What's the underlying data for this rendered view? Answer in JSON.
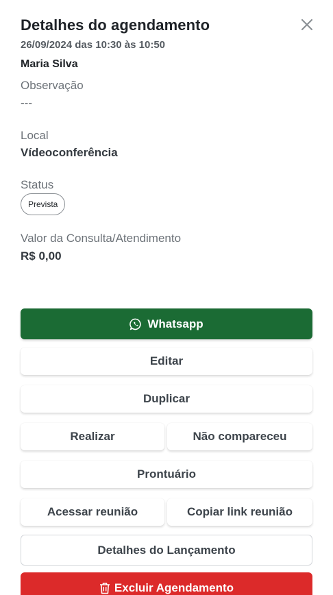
{
  "modal": {
    "title": "Detalhes do agendamento",
    "datetime": "26/09/2024 das 10:30 às 10:50",
    "patient_name": "Maria Silva"
  },
  "fields": {
    "observacao_label": "Observação",
    "observacao_value": "---",
    "local_label": "Local",
    "local_value": "Vídeoconferência",
    "status_label": "Status",
    "status_value": "Prevista",
    "valor_label": "Valor da Consulta/Atendimento",
    "valor_value": "R$ 0,00"
  },
  "actions": {
    "whatsapp": "Whatsapp",
    "editar": "Editar",
    "duplicar": "Duplicar",
    "realizar": "Realizar",
    "nao_compareceu": "Não compareceu",
    "prontuario": "Prontuário",
    "acessar_reuniao": "Acessar reunião",
    "copiar_link": "Copiar link reunião",
    "detalhes_lancamento": "Detalhes do Lançamento",
    "excluir": "Excluir Agendamento"
  },
  "icons": {
    "close": "close-icon",
    "whatsapp": "whatsapp-icon",
    "trash": "trash-icon"
  },
  "colors": {
    "whatsapp_green": "#1b6b34",
    "danger_red": "#dc2a2a"
  }
}
